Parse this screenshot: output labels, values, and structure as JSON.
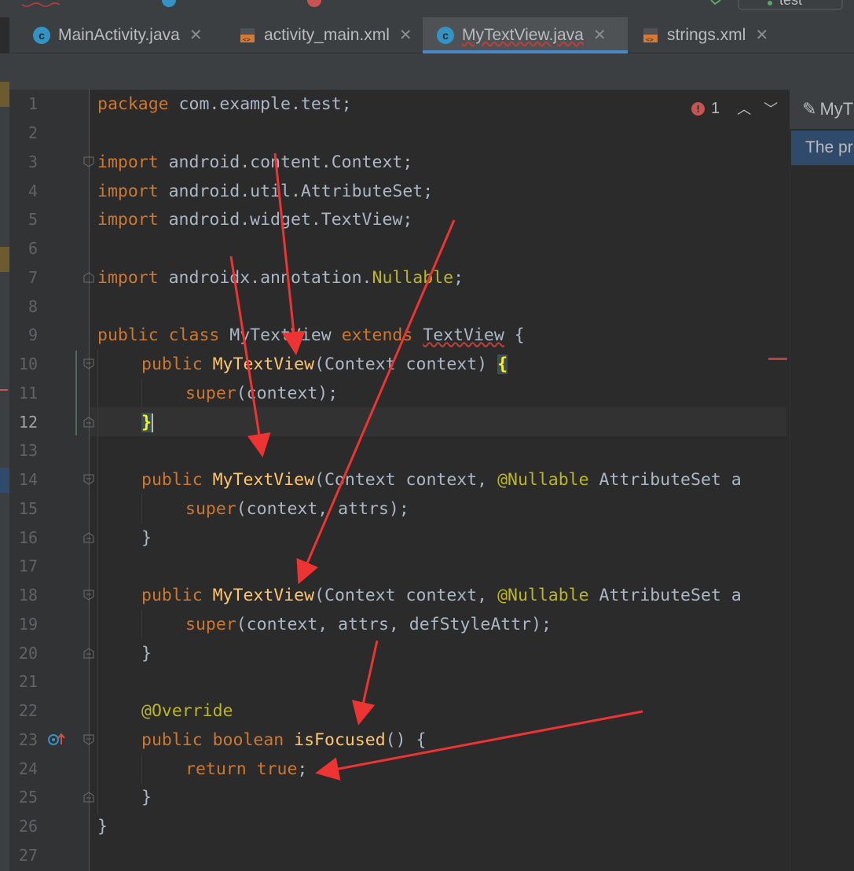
{
  "tabs": [
    {
      "label": "MainActivity.java",
      "type": "java",
      "active": false
    },
    {
      "label": "activity_main.xml",
      "type": "xml",
      "active": false
    },
    {
      "label": "MyTextView.java",
      "type": "java",
      "active": true
    },
    {
      "label": "strings.xml",
      "type": "xml",
      "active": false
    }
  ],
  "top": {
    "run_config": "test"
  },
  "inspection": {
    "error_count": "1"
  },
  "right_panel": {
    "title": "MyT",
    "text": "The pr"
  },
  "line_numbers": [
    "1",
    "2",
    "3",
    "4",
    "5",
    "6",
    "7",
    "8",
    "9",
    "10",
    "11",
    "12",
    "13",
    "14",
    "15",
    "16",
    "17",
    "18",
    "19",
    "20",
    "21",
    "22",
    "23",
    "24",
    "25",
    "26",
    "27"
  ],
  "current_line": "12",
  "code": {
    "l1": {
      "kw": "package",
      "rest": " com.example.test;"
    },
    "l3": {
      "kw": "import",
      "rest": " android.content.Context;"
    },
    "l4": {
      "kw": "import",
      "rest": " android.util.AttributeSet;"
    },
    "l5": {
      "kw": "import",
      "rest": " android.widget.TextView;"
    },
    "l7": {
      "kw": "import",
      "pre": " androidx.annotation.",
      "ann": "Nullable",
      "post": ";"
    },
    "l9": {
      "kw1": "public class",
      "name": " MyTextView ",
      "kw2": "extends",
      "sp": " ",
      "typo": "TextView",
      "post": " {"
    },
    "l10": {
      "kw": "public",
      "fn": " MyTextView",
      "mid": "(Context context) ",
      "brace": "{"
    },
    "l11": {
      "kw": "super",
      "rest": "(context);"
    },
    "l12": {
      "brace": "}"
    },
    "l14": {
      "kw": "public",
      "fn": " MyTextView",
      "mid": "(Context context, ",
      "ann": "@Nullable",
      "rest": " AttributeSet a"
    },
    "l15": {
      "kw": "super",
      "rest": "(context, attrs);"
    },
    "l16": {
      "rest": "}"
    },
    "l18": {
      "kw": "public",
      "fn": " MyTextView",
      "mid": "(Context context, ",
      "ann": "@Nullable",
      "rest": " AttributeSet a"
    },
    "l19": {
      "kw": "super",
      "rest": "(context, attrs, defStyleAttr);"
    },
    "l20": {
      "rest": "}"
    },
    "l22": {
      "ann": "@Override"
    },
    "l23": {
      "kw": "public boolean",
      "fn": " isFocused",
      "rest": "() {"
    },
    "l24": {
      "kw": "return true",
      "rest": ";"
    },
    "l25": {
      "rest": "}"
    },
    "l26": {
      "rest": "}"
    }
  },
  "colors": {
    "keyword": "#cc7832",
    "function": "#ffc66d",
    "annotation": "#bbb529",
    "text": "#a9b7c6",
    "arrow": "#ee3333",
    "accent": "#4a88c7"
  }
}
